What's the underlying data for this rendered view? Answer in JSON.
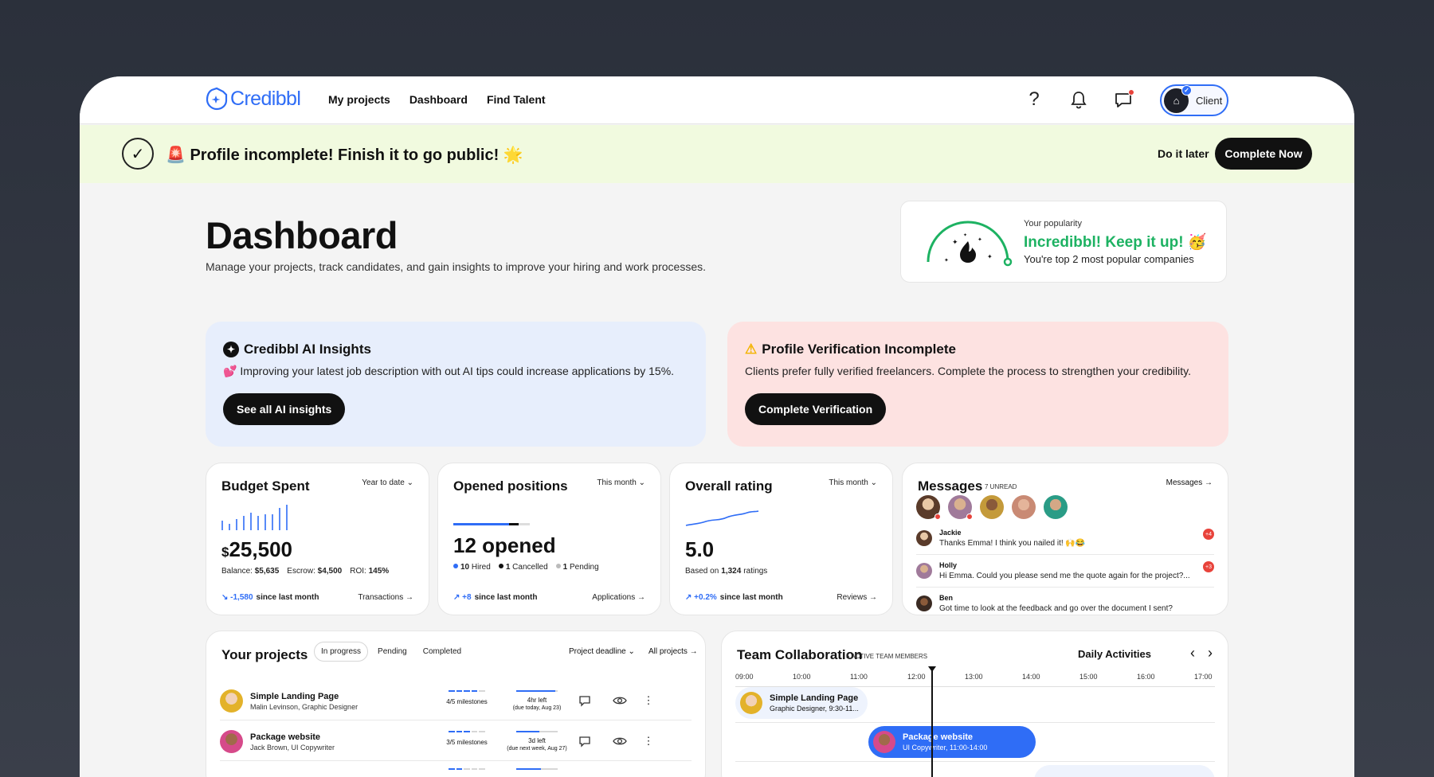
{
  "app": {
    "name": "Credibbl",
    "brand_color": "#2f6df6"
  },
  "nav": {
    "links": [
      "My projects",
      "Dashboard",
      "Find Talent"
    ],
    "icons": [
      "help-icon",
      "bell-icon",
      "chat-icon"
    ],
    "account_label": "Client"
  },
  "banner": {
    "text": "🚨 Profile incomplete! Finish it to go public! 🌟",
    "later": "Do it later",
    "cta": "Complete Now"
  },
  "header": {
    "title": "Dashboard",
    "subtitle": "Manage your projects, track candidates, and gain insights to improve your hiring and work processes."
  },
  "popularity": {
    "label": "Your popularity",
    "headline": "Incredibbl! Keep it up! 🥳",
    "detail": "You're top 2 most popular companies"
  },
  "ai_insights": {
    "title": "Credibbl AI Insights",
    "text": "💕 Improving your latest job description with out AI tips could increase applications by 15%.",
    "button": "See all AI insights"
  },
  "verification": {
    "title": "Profile Verification Incomplete",
    "text": "Clients prefer fully verified freelancers. Complete the process to strengthen your credibility.",
    "button": "Complete Verification"
  },
  "budget": {
    "title": "Budget Spent",
    "filter": "Year to date ⌄",
    "amount": "25,500",
    "currency": "$",
    "balance_label": "Balance:",
    "balance": "$5,635",
    "escrow_label": "Escrow:",
    "escrow": "$4,500",
    "roi_label": "ROI:",
    "roi": "145%",
    "delta": "↘ -1,580",
    "delta_suffix": "since last month",
    "link": "Transactions →"
  },
  "positions": {
    "title": "Opened positions",
    "filter": "This month ⌄",
    "headline": "12 opened",
    "hired": "10",
    "hired_label": "Hired",
    "cancelled": "1",
    "cancelled_label": "Cancelled",
    "pending": "1",
    "pending_label": "Pending",
    "delta": "↗ +8",
    "delta_suffix": "since last month",
    "link": "Applications →"
  },
  "rating": {
    "title": "Overall rating",
    "filter": "This month ⌄",
    "value": "5.0",
    "based_prefix": "Based on",
    "based_count": "1,324",
    "based_suffix": "ratings",
    "delta": "↗ +0.2%",
    "delta_suffix": "since last month",
    "link": "Reviews →"
  },
  "messages": {
    "title": "Messages",
    "unread": "7 UNREAD",
    "link": "Messages →",
    "threads": [
      {
        "name": "Jackie",
        "text": "Thanks Emma! I think you nailed it! 🙌😂",
        "badge": "+4"
      },
      {
        "name": "Holly",
        "text": "Hi Emma. Could you please send me the quote again for the project?...",
        "badge": "+3"
      },
      {
        "name": "Ben",
        "text": "Got time to look at the feedback and go over the document I sent?",
        "badge": ""
      }
    ]
  },
  "projects": {
    "title": "Your projects",
    "tabs": [
      "In progress",
      "Pending",
      "Completed"
    ],
    "sort": "Project deadline ⌄",
    "all_link": "All projects →",
    "rows": [
      {
        "name": "Simple Landing Page",
        "desc": "Malin Levinson, Graphic Designer",
        "milestones": "4/5 milestones",
        "milestones_done": 4,
        "time": "4hr left",
        "time_sub": "(due today, Aug 23)",
        "time_progress": 0.95
      },
      {
        "name": "Package website",
        "desc": "Jack Brown, UI Copywriter",
        "milestones": "3/5 milestones",
        "milestones_done": 3,
        "time": "3d left",
        "time_sub": "(due next week, Aug 27)",
        "time_progress": 0.55
      }
    ]
  },
  "team": {
    "title": "Team Collaboration",
    "members": "5 ACTIVE TEAM MEMBERS",
    "view": "Daily Activities",
    "hours": [
      "09:00",
      "10:00",
      "11:00",
      "12:00",
      "13:00",
      "14:00",
      "15:00",
      "16:00",
      "17:00"
    ],
    "events": [
      {
        "name": "Simple Landing Page",
        "desc": "Graphic Designer, 9:30-11..."
      },
      {
        "name": "Package website",
        "desc": "UI Copywriter, 11:00-14:00"
      }
    ]
  }
}
